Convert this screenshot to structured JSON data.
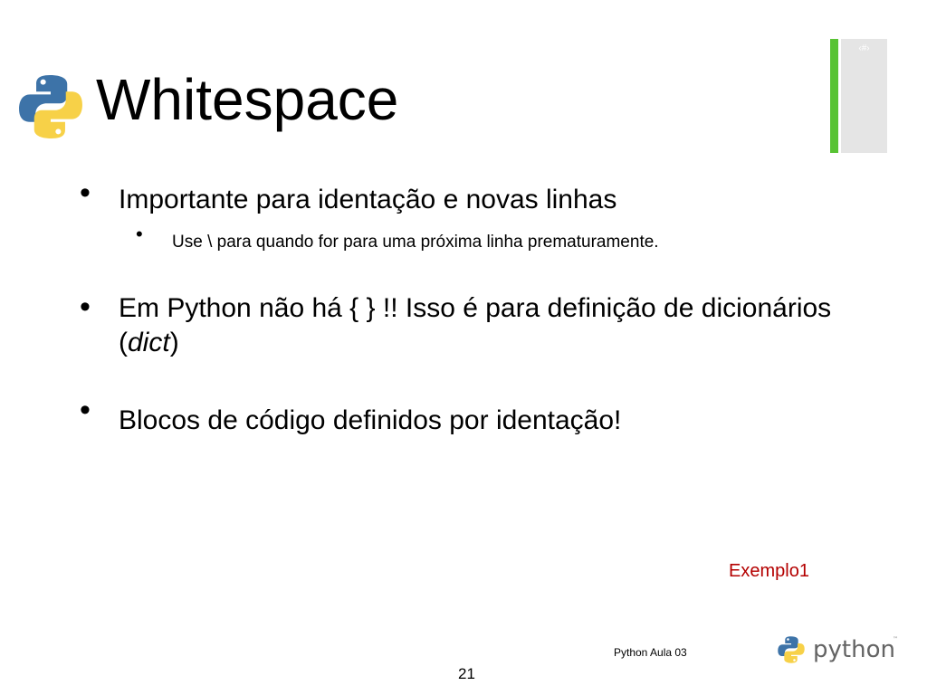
{
  "slide": {
    "header_placeholder": "‹#›",
    "title": "Whitespace",
    "bullets": [
      {
        "text": "Importante para identação e novas linhas",
        "sub": [
          "Use \\  para quando for para uma próxima linha prematuramente."
        ]
      },
      {
        "text_before": "Em Python  não há { } !! Isso é para definição de dicionários (",
        "text_italic": "dict",
        "text_after": ")"
      },
      {
        "text": "Blocos de código definidos por identação!"
      }
    ],
    "example_link": "Exemplo1",
    "footer": "Python Aula 03",
    "page_number": "21",
    "brand_logo_text": "python",
    "trademark": "™"
  },
  "colors": {
    "accent_green": "#58c334",
    "panel_gray": "#e5e5e5",
    "python_blue": "#3d73a8",
    "python_yellow": "#f7d148",
    "example_red": "#b40000"
  }
}
